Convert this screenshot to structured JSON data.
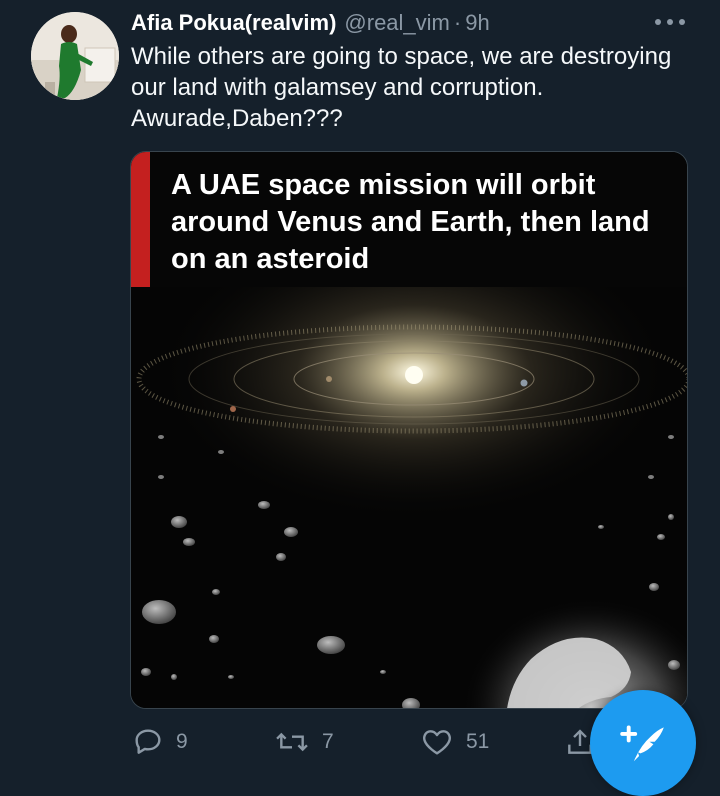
{
  "tweet": {
    "display_name": "Afia Pokua(realvim)",
    "handle": "@real_vim",
    "separator": "·",
    "time": "9h",
    "text": "While others are going to space, we are destroying our land with galamsey and corruption.\nAwurade,Daben???",
    "more_icon": "more-horizontal-icon",
    "avatar_icon": "avatar-photo"
  },
  "media": {
    "headline": "A UAE space mission will orbit around Venus and Earth, then land on an asteroid",
    "accent_color": "#c4201f",
    "image_description_icon": "asteroid-belt-illustration"
  },
  "actions": {
    "reply": {
      "icon": "reply-icon",
      "count": "9"
    },
    "retweet": {
      "icon": "retweet-icon",
      "count": "7"
    },
    "like": {
      "icon": "heart-icon",
      "count": "51"
    },
    "share": {
      "icon": "share-icon"
    }
  },
  "compose_button": {
    "icon": "compose-tweet-icon",
    "color": "#1d9bf0"
  },
  "colors": {
    "background": "#15202b",
    "secondary_text": "#8b98a5",
    "primary_text": "#f5f8fa"
  }
}
